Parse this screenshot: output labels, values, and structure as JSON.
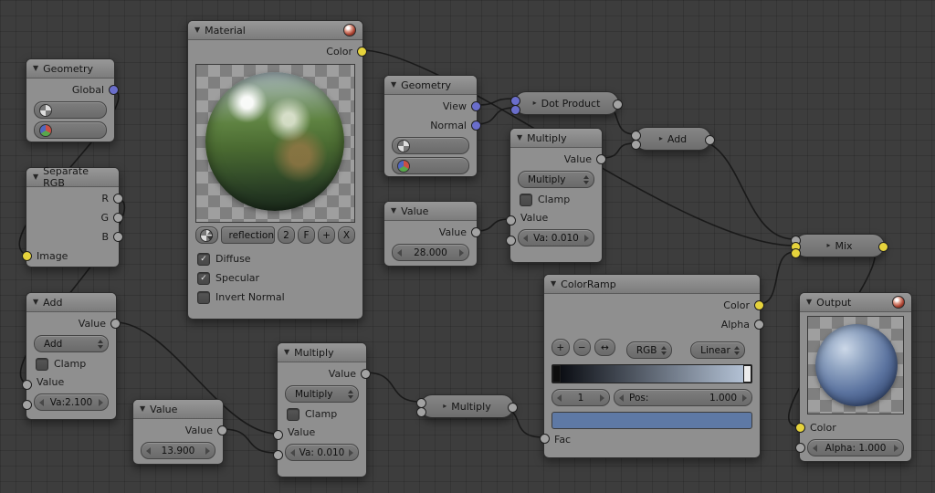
{
  "ui": {
    "collapse_arrow": "▼",
    "collapsed_arrow": "▸",
    "check": "✓"
  },
  "nodes": {
    "geometry_left": {
      "title": "Geometry",
      "global_label": "Global"
    },
    "separate_rgb": {
      "title": "Separate RGB",
      "r": "R",
      "g": "G",
      "b": "B",
      "image": "Image"
    },
    "add_math": {
      "title": "Add",
      "value_out": "Value",
      "operation": "Add",
      "clamp": "Clamp",
      "value_in": "Value",
      "value_field": "Va:2.100"
    },
    "value_small": {
      "title": "Value",
      "value_label": "Value",
      "value": "13.900"
    },
    "material": {
      "title": "Material",
      "color_out": "Color",
      "tex_name": "reflection",
      "users": "2",
      "fake": "F",
      "add": "+",
      "close": "X",
      "diffuse": "Diffuse",
      "specular": "Specular",
      "invert": "Invert Normal"
    },
    "geometry_mid": {
      "title": "Geometry",
      "view": "View",
      "normal": "Normal"
    },
    "value_28": {
      "title": "Value",
      "value_label": "Value",
      "value": "28.000"
    },
    "dot_product": {
      "title": "Dot Product"
    },
    "multiply_a": {
      "title": "Multiply",
      "value_out": "Value",
      "operation": "Multiply",
      "clamp": "Clamp",
      "value_in": "Value",
      "value_field": "Va: 0.010"
    },
    "add_mini": {
      "title": "Add"
    },
    "multiply_b": {
      "title": "Multiply",
      "value_out": "Value",
      "operation": "Multiply",
      "clamp": "Clamp",
      "value_in": "Value",
      "value_field": "Va: 0.010"
    },
    "multiply_mini": {
      "title": "Multiply"
    },
    "colorramp": {
      "title": "ColorRamp",
      "color_out": "Color",
      "alpha_out": "Alpha",
      "add": "+",
      "del": "−",
      "flip": "↔",
      "mode": "RGB",
      "interp": "Linear",
      "index": "1",
      "pos_label": "Pos:",
      "pos": "1.000",
      "fac": "Fac",
      "swatch": "#5e79a5",
      "ramp_start": "#04060b",
      "ramp_end": "#bac9dd"
    },
    "mix": {
      "title": "Mix"
    },
    "output": {
      "title": "Output",
      "color_in": "Color",
      "alpha_field": "Alpha: 1.000"
    }
  }
}
